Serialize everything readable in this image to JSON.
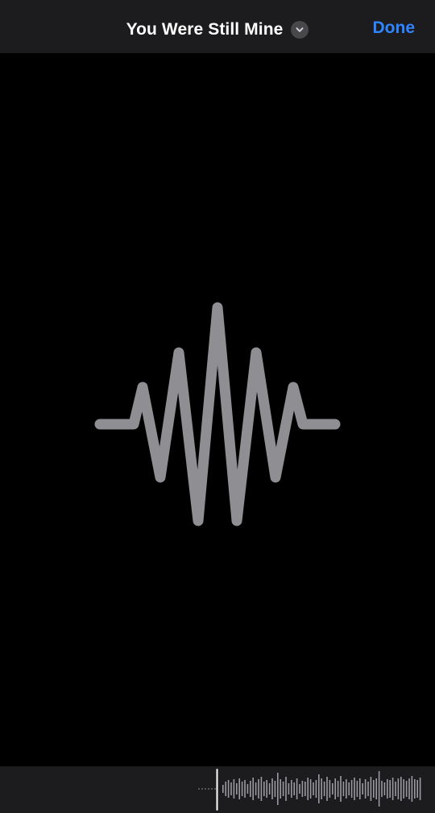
{
  "nav": {
    "title": "You Were Still Mine",
    "chevron_icon": "chevron-down-icon",
    "done_label": "Done"
  },
  "main": {
    "icon": "waveform-icon"
  },
  "scrubber": {
    "icon": "audio-waveform-scrubber"
  },
  "colors": {
    "background": "#000000",
    "bar": "#1c1c1e",
    "accent": "#2f85ff",
    "glyph": "#8e8e93"
  }
}
